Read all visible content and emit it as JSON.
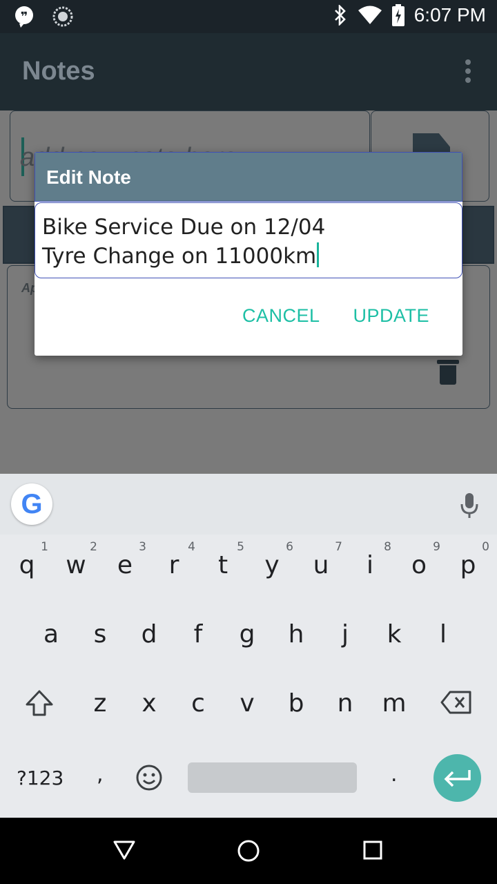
{
  "status_bar": {
    "time": "6:07 PM",
    "icons": [
      "quote-notification-icon",
      "sync-icon",
      "bluetooth-icon",
      "wifi-icon",
      "battery-icon"
    ]
  },
  "app_bar": {
    "title": "Notes",
    "menu_icon": "overflow-menu-icon"
  },
  "background": {
    "note_input_hint": "add new note here",
    "note_preview": "Ap"
  },
  "dialog": {
    "title": "Edit Note",
    "text_line1": "Bike Service Due on 12/04",
    "text_line2": "Tyre Change on 11000km",
    "cancel_label": "CANCEL",
    "update_label": "UPDATE",
    "accent_color": "#1dbfa5",
    "title_bg_color": "#607d8b"
  },
  "keyboard": {
    "row1": [
      {
        "key": "q",
        "hint": "1"
      },
      {
        "key": "w",
        "hint": "2"
      },
      {
        "key": "e",
        "hint": "3"
      },
      {
        "key": "r",
        "hint": "4"
      },
      {
        "key": "t",
        "hint": "5"
      },
      {
        "key": "y",
        "hint": "6"
      },
      {
        "key": "u",
        "hint": "7"
      },
      {
        "key": "i",
        "hint": "8"
      },
      {
        "key": "o",
        "hint": "9"
      },
      {
        "key": "p",
        "hint": "0"
      }
    ],
    "row2": [
      "a",
      "s",
      "d",
      "f",
      "g",
      "h",
      "j",
      "k",
      "l"
    ],
    "row3": [
      "z",
      "x",
      "c",
      "v",
      "b",
      "n",
      "m"
    ],
    "symbols_label": "?123",
    "comma": ",",
    "period": ".",
    "google_label": "G",
    "enter_color": "#4db6ac"
  },
  "nav_bar": {
    "icons": [
      "back-icon",
      "home-icon",
      "recents-icon"
    ]
  }
}
